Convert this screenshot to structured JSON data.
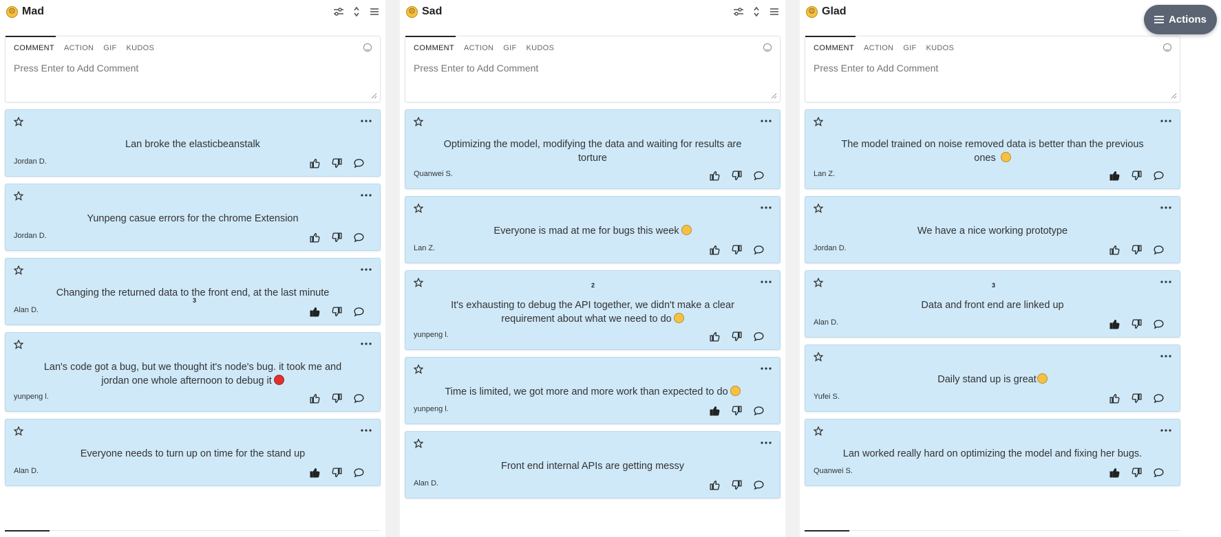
{
  "composer": {
    "tabs": [
      "COMMENT",
      "ACTION",
      "GIF",
      "KUDOS"
    ],
    "placeholder": "Press Enter to Add Comment"
  },
  "actions_button": {
    "label": "Actions"
  },
  "columns": [
    {
      "title": "Mad",
      "emoji": "mad-face-icon",
      "cards": [
        {
          "text": "Lan broke the elasticbeanstalk",
          "author": "Jordan D.",
          "liked": false
        },
        {
          "text": "Yunpeng casue errors for the chrome Extension",
          "author": "Jordan D.",
          "liked": false
        },
        {
          "text": "Changing the returned data to the front end, at the last minute",
          "author": "Alan D.",
          "liked": true,
          "count": "3"
        },
        {
          "text": "Lan's code got a bug, but we thought it's node's bug. it took me and jordan one whole afternoon to debug it",
          "author": "yunpeng l.",
          "liked": false,
          "emoji": "angry-face-icon"
        },
        {
          "text": "Everyone needs to turn up on time for the stand up",
          "author": "Alan D.",
          "liked": true
        }
      ]
    },
    {
      "title": "Sad",
      "emoji": "sad-face-icon",
      "cards": [
        {
          "text": "Optimizing the model, modifying the data and waiting for results are torture",
          "author": "Quanwei S.",
          "liked": false
        },
        {
          "text": "Everyone is mad at me for bugs this week",
          "author": "Lan Z.",
          "liked": false,
          "emoji": "crying-face-icon"
        },
        {
          "text": "It's exhausting to debug the API together, we didn't make a clear requirement about what we need to do",
          "author": "yunpeng l.",
          "liked": false,
          "count": "2",
          "emoji": "expressionless-face-icon"
        },
        {
          "text": "Time is limited, we got more and more work than expected to do",
          "author": "yunpeng l.",
          "liked": true,
          "emoji": "crying-face-icon"
        },
        {
          "text": "Front end internal APIs are getting messy",
          "author": "Alan D.",
          "liked": false
        }
      ]
    },
    {
      "title": "Glad",
      "emoji": "glad-face-icon",
      "cards": [
        {
          "text": "The model trained on noise removed data is better than the previous ones",
          "author": "Lan Z.",
          "liked": true,
          "emoji": "smiling-face-icon"
        },
        {
          "text": "We have a nice working prototype",
          "author": "Jordan D.",
          "liked": false
        },
        {
          "text": "Data and front end are linked up",
          "author": "Alan D.",
          "liked": true,
          "count": "3"
        },
        {
          "text": "Daily stand up is great",
          "author": "Yufei S.",
          "liked": false,
          "emoji": "grinning-face-icon"
        },
        {
          "text": "Lan worked really hard on optimizing the model and fixing her bugs.",
          "author": "Quanwei S.",
          "liked": true
        }
      ]
    }
  ],
  "colors": {
    "card_bg": "#cfe9f8",
    "actions_bg": "#5a6472"
  }
}
